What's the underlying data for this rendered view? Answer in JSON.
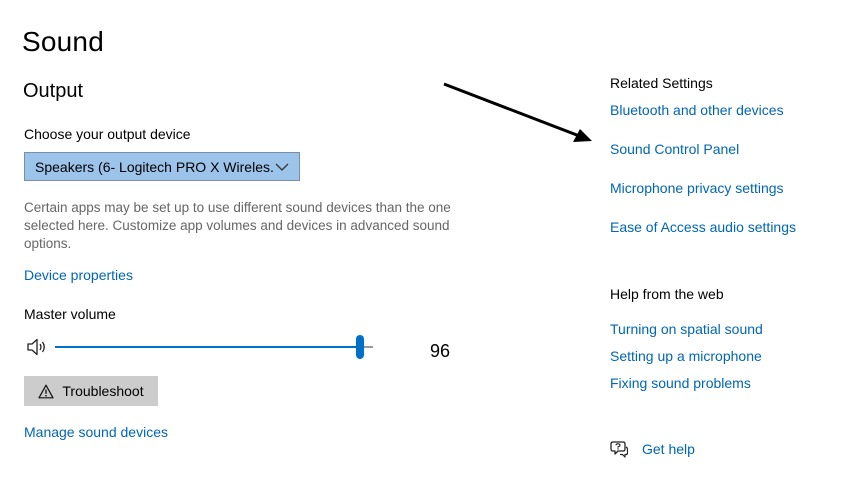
{
  "header": {
    "title": "Sound"
  },
  "output": {
    "section_title": "Output",
    "device_label": "Choose your output device",
    "device_selected": "Speakers (6- Logitech PRO X Wireles...",
    "help_text": "Certain apps may be set up to use different sound devices than the one selected here. Customize app volumes and devices in advanced sound options.",
    "device_properties_link": "Device properties",
    "volume_label": "Master volume",
    "volume_value": "96",
    "volume_level": 96,
    "troubleshoot_label": "Troubleshoot",
    "manage_link": "Manage sound devices"
  },
  "related": {
    "heading": "Related Settings",
    "links": [
      "Bluetooth and other devices",
      "Sound Control Panel",
      "Microphone privacy settings",
      "Ease of Access audio settings"
    ]
  },
  "help_web": {
    "heading": "Help from the web",
    "links": [
      "Turning on spatial sound",
      "Setting up a microphone",
      "Fixing sound problems"
    ]
  },
  "get_help": {
    "label": "Get help"
  },
  "icons": {
    "speaker": "speaker-icon",
    "warning": "warning-icon",
    "chevron": "chevron-down-icon",
    "help": "help-chat-icon"
  },
  "colors": {
    "link": "#0066b4",
    "accent": "#0070c9",
    "select_bg": "#9cc3ea",
    "button_bg": "#cccccc",
    "secondary_text": "#666666"
  }
}
